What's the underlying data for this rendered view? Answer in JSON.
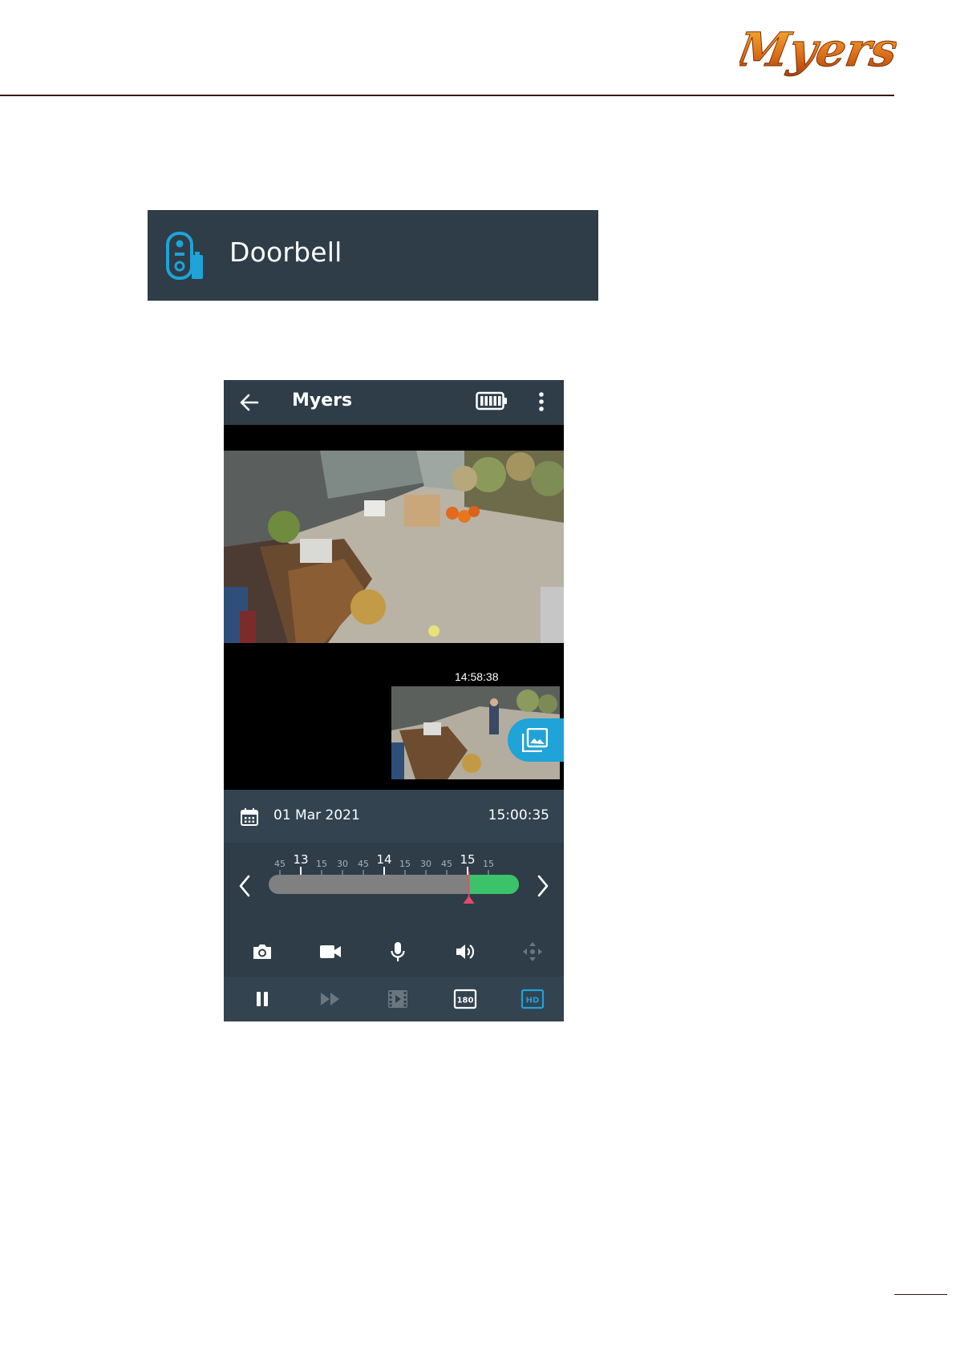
{
  "header": {
    "logo_text": "Myers"
  },
  "doorbell_banner": {
    "title": "Doorbell"
  },
  "app": {
    "title": "Myers",
    "thumbnail_time": "14:58:38",
    "date": "01 Mar 2021",
    "time": "15:00:35",
    "timeline": {
      "labels": [
        {
          "text": "45",
          "major": false
        },
        {
          "text": "13",
          "major": true
        },
        {
          "text": "15",
          "major": false
        },
        {
          "text": "30",
          "major": false
        },
        {
          "text": "45",
          "major": false
        },
        {
          "text": "14",
          "major": true
        },
        {
          "text": "15",
          "major": false
        },
        {
          "text": "30",
          "major": false
        },
        {
          "text": "45",
          "major": false
        },
        {
          "text": "15",
          "major": true
        },
        {
          "text": "15",
          "major": false
        }
      ],
      "recorded_fraction": 0.8
    },
    "colors": {
      "bar": "#2e3d47",
      "accent": "#1fa3d8",
      "green": "#3cc26a",
      "marker": "#e8496a"
    }
  }
}
